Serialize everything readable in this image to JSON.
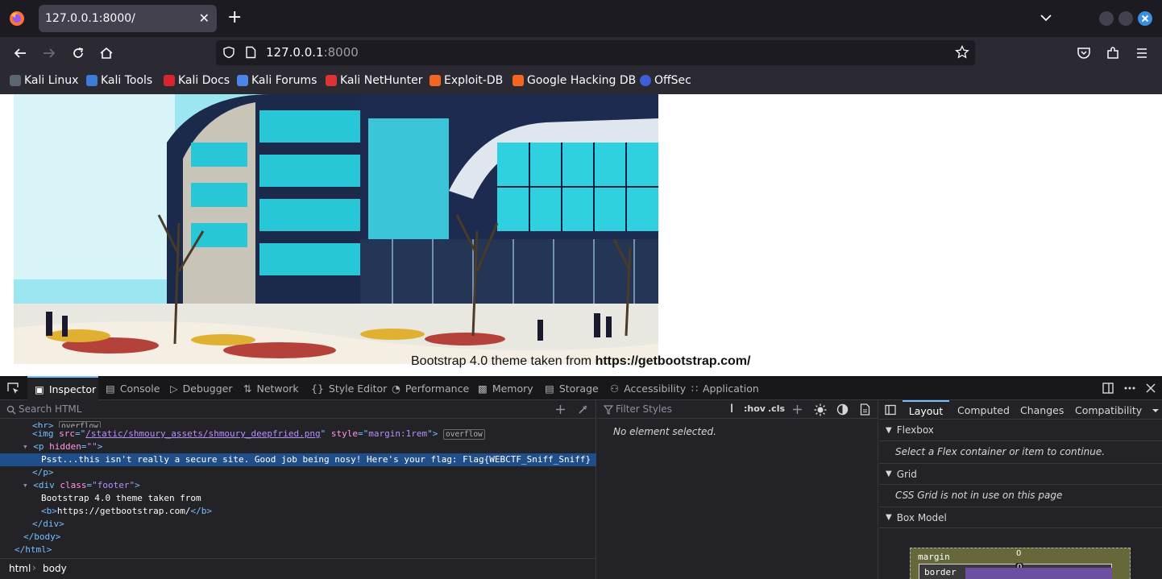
{
  "tabstrip": {
    "tab_title": "127.0.0.1:8000/",
    "close_glyph": "✕",
    "new_tab_glyph": "+"
  },
  "navbar": {
    "url_host": "127.0.0.1",
    "url_port": ":8000"
  },
  "bookmarks": [
    {
      "label": "Kali Linux",
      "icon": "kali-linux-icon",
      "color": "#5b6770"
    },
    {
      "label": "Kali Tools",
      "icon": "kali-tools-icon",
      "color": "#3d7bd9"
    },
    {
      "label": "Kali Docs",
      "icon": "kali-docs-icon",
      "color": "#d7262e"
    },
    {
      "label": "Kali Forums",
      "icon": "kali-forums-icon",
      "color": "#4a86e8"
    },
    {
      "label": "Kali NetHunter",
      "icon": "kali-nethunter-icon",
      "color": "#d33"
    },
    {
      "label": "Exploit-DB",
      "icon": "exploit-db-icon",
      "color": "#f26522"
    },
    {
      "label": "Google Hacking DB",
      "icon": "ghdb-icon",
      "color": "#f26522"
    },
    {
      "label": "OffSec",
      "icon": "offsec-icon",
      "color": "#3f5fd6"
    }
  ],
  "page": {
    "footer_prefix": "Bootstrap 4.0 theme taken from ",
    "footer_link": "https://getbootstrap.com/"
  },
  "devtools": {
    "tabs": [
      {
        "label": "Inspector",
        "icon": "inspector-icon",
        "selected": true
      },
      {
        "label": "Console",
        "icon": "console-icon"
      },
      {
        "label": "Debugger",
        "icon": "debugger-icon"
      },
      {
        "label": "Network",
        "icon": "network-icon"
      },
      {
        "label": "Style Editor",
        "icon": "style-editor-icon"
      },
      {
        "label": "Performance",
        "icon": "performance-icon"
      },
      {
        "label": "Memory",
        "icon": "memory-icon"
      },
      {
        "label": "Storage",
        "icon": "storage-icon"
      },
      {
        "label": "Accessibility",
        "icon": "accessibility-icon"
      },
      {
        "label": "Application",
        "icon": "application-icon"
      }
    ],
    "markup": {
      "search_placeholder": "Search HTML",
      "line0_tag": "<br>",
      "line0_badge": "overflow",
      "line1_open": "<img ",
      "line1_src_attr": "src",
      "line1_src_val": "/static/shmoury_assets/shmoury_deepfried.png",
      "line1_style_attr": "style",
      "line1_style_val": "margin:1rem",
      "line1_close": ">",
      "line1_badge": "overflow",
      "line2_open": "<p ",
      "line2_attr": "hidden",
      "line2_val": "\"\"",
      "line2_close": ">",
      "line3_text": "Psst...this isn't really a secure site. Good job being nosy! Here's your flag: Flag{WEBCTF_Sniff_Sniff}",
      "line4": "</p>",
      "line5_open": "<div ",
      "line5_attr": "class",
      "line5_val": "\"footer\"",
      "line5_close": ">",
      "line6": "Bootstrap 4.0 theme taken from",
      "line7_open": "<b>",
      "line7_text": "https://getbootstrap.com/",
      "line7_close": "</b>",
      "line8": "</div>",
      "line9": "</body>",
      "line10": "</html>"
    },
    "breadcrumbs": [
      "html",
      "body"
    ],
    "rules": {
      "filter_placeholder": "Filter Styles",
      "hov": ":hov",
      "cls": ".cls",
      "empty_message": "No element selected."
    },
    "side": {
      "tabs": [
        "Layout",
        "Computed",
        "Changes",
        "Compatibility"
      ],
      "sections": [
        {
          "title": "Flexbox",
          "message": "Select a Flex container or item to continue."
        },
        {
          "title": "Grid",
          "message": "CSS Grid is not in use on this page"
        },
        {
          "title": "Box Model"
        }
      ],
      "box_model": {
        "margin_label": "margin",
        "margin_value": "0",
        "border_label": "border",
        "border_value": "0"
      }
    }
  }
}
